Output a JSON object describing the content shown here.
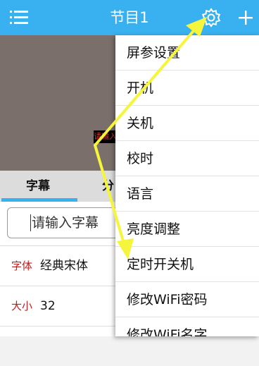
{
  "header": {
    "title": "节目1",
    "menu_icon": "menu-icon",
    "settings_icon": "gear-icon",
    "add_icon": "plus-icon"
  },
  "preview": {
    "text": "请输入字幕"
  },
  "tabs": [
    {
      "label": "字幕",
      "active": true
    },
    {
      "label": "分"
    }
  ],
  "subtitle_input": {
    "placeholder": "请输入字幕"
  },
  "rows": [
    {
      "label": "字体",
      "value": "经典宋体"
    },
    {
      "label": "大小",
      "value": "32"
    }
  ],
  "dropdown": {
    "items": [
      {
        "label": "屏参设置"
      },
      {
        "label": "开机"
      },
      {
        "label": "关机"
      },
      {
        "label": "校时"
      },
      {
        "label": "语言"
      },
      {
        "label": "亮度调整"
      },
      {
        "label": "定时开关机"
      },
      {
        "label": "修改WiFi密码"
      },
      {
        "label": "修改WiFi名字"
      }
    ]
  },
  "colors": {
    "header": "#39b0f0",
    "accent_label": "#c0201e",
    "annotation_arrow": "#f5f53c"
  }
}
